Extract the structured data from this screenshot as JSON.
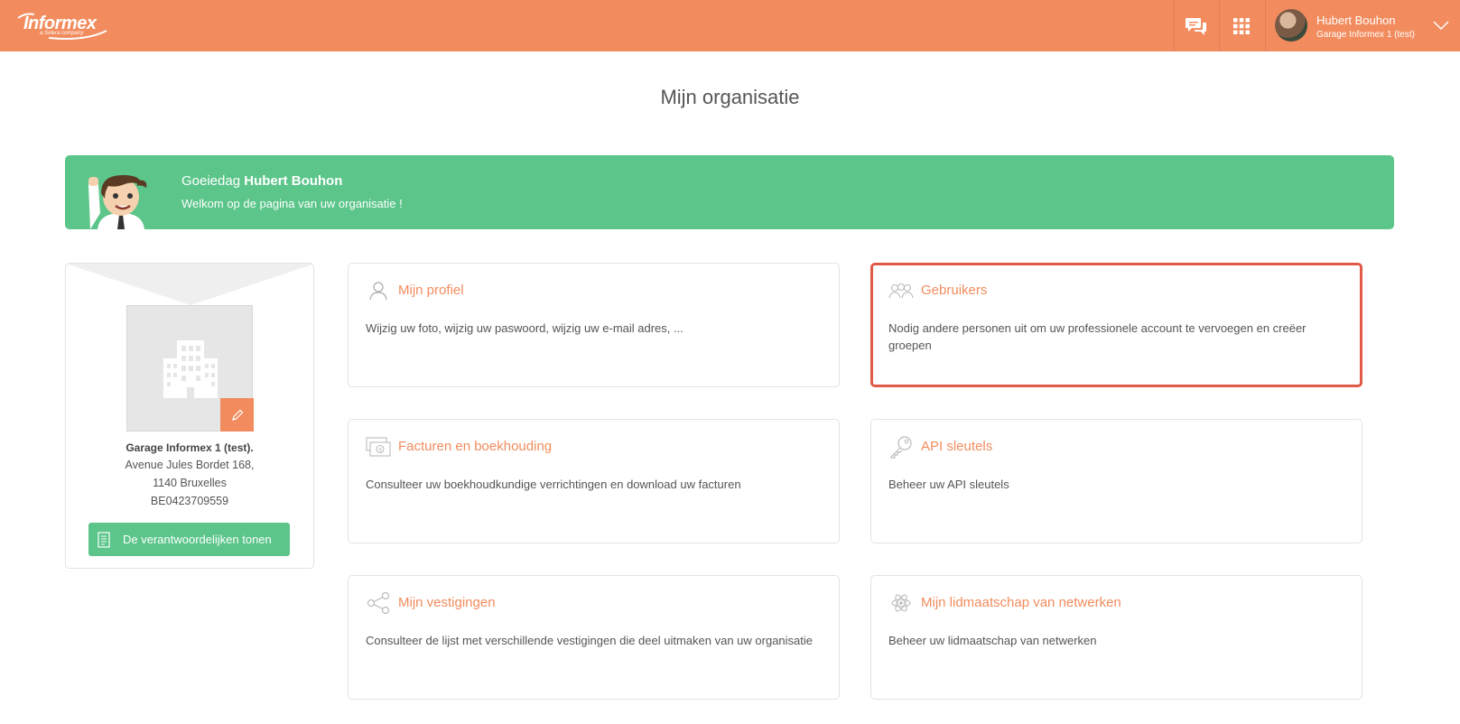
{
  "header": {
    "logo_text": "Informex",
    "logo_sub": "a Solera company",
    "user_name": "Hubert Bouhon",
    "user_org": "Garage Informex 1 (test)",
    "accent_color": "#F28C5E"
  },
  "page": {
    "title": "Mijn organisatie"
  },
  "banner": {
    "greeting_prefix": "Goeiedag",
    "greeting_name": "Hubert Bouhon",
    "welcome": "Welkom op de pagina van uw organisatie !",
    "color": "#5BC58A"
  },
  "organisation": {
    "name": "Garage Informex 1 (test).",
    "address_line1": "Avenue Jules Bordet 168,",
    "address_line2": "1140 Bruxelles",
    "vat": "BE0423709559",
    "button_label": "De verantwoordelijken tonen"
  },
  "tiles": [
    {
      "title": "Mijn profiel",
      "description": "Wijzig uw foto, wijzig uw paswoord, wijzig uw e-mail adres, ...",
      "icon": "user-icon"
    },
    {
      "title": "Gebruikers",
      "description": "Nodig andere personen uit om uw professionele account te vervoegen en creëer groepen",
      "icon": "users-icon",
      "selected": true
    },
    {
      "title": "Facturen en boekhouding",
      "description": "Consulteer uw boekhoudkundige verrichtingen en download uw facturen",
      "icon": "invoice-icon"
    },
    {
      "title": "API sleutels",
      "description": "Beheer uw API sleutels",
      "icon": "key-icon"
    },
    {
      "title": "Mijn vestigingen",
      "description": "Consulteer de lijst met verschillende vestigingen die deel uitmaken van uw organisatie",
      "icon": "share-nodes-icon"
    },
    {
      "title": "Mijn lidmaatschap van netwerken",
      "description": "Beheer uw lidmaatschap van netwerken",
      "icon": "atom-network-icon"
    }
  ]
}
